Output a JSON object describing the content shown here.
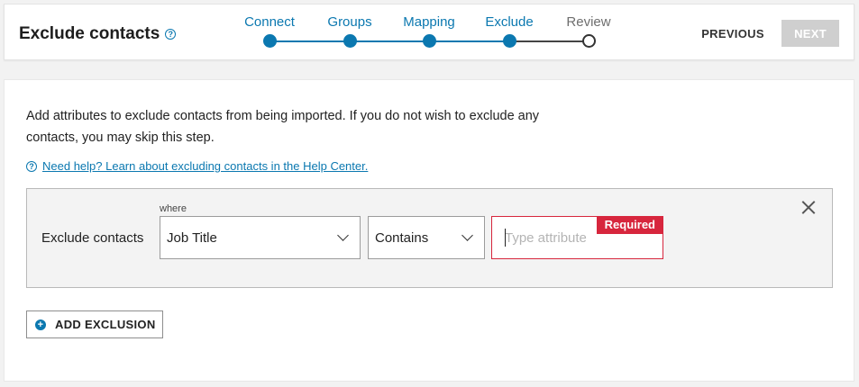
{
  "header": {
    "title": "Exclude contacts",
    "help_icon": "question-circle-icon",
    "previous_label": "PREVIOUS",
    "next_label": "NEXT",
    "steps": [
      {
        "label": "Connect",
        "state": "done"
      },
      {
        "label": "Groups",
        "state": "done"
      },
      {
        "label": "Mapping",
        "state": "done"
      },
      {
        "label": "Exclude",
        "state": "done"
      },
      {
        "label": "Review",
        "state": "todo"
      }
    ]
  },
  "main": {
    "description": "Add attributes to exclude contacts from being imported. If you do not wish to exclude any contacts, you may skip this step.",
    "help_link": "Need help? Learn about excluding contacts in the Help Center.",
    "rule": {
      "label": "Exclude contacts",
      "where_label": "where",
      "field_value": "Job Title",
      "operator_value": "Contains",
      "attribute_placeholder": "Type attribute",
      "attribute_value": "",
      "required_badge": "Required",
      "close_icon": "close-icon"
    },
    "add_button_label": "ADD EXCLUSION"
  },
  "colors": {
    "accent": "#0b78b0",
    "error": "#d7263d",
    "disabled": "#cfcfcf"
  }
}
